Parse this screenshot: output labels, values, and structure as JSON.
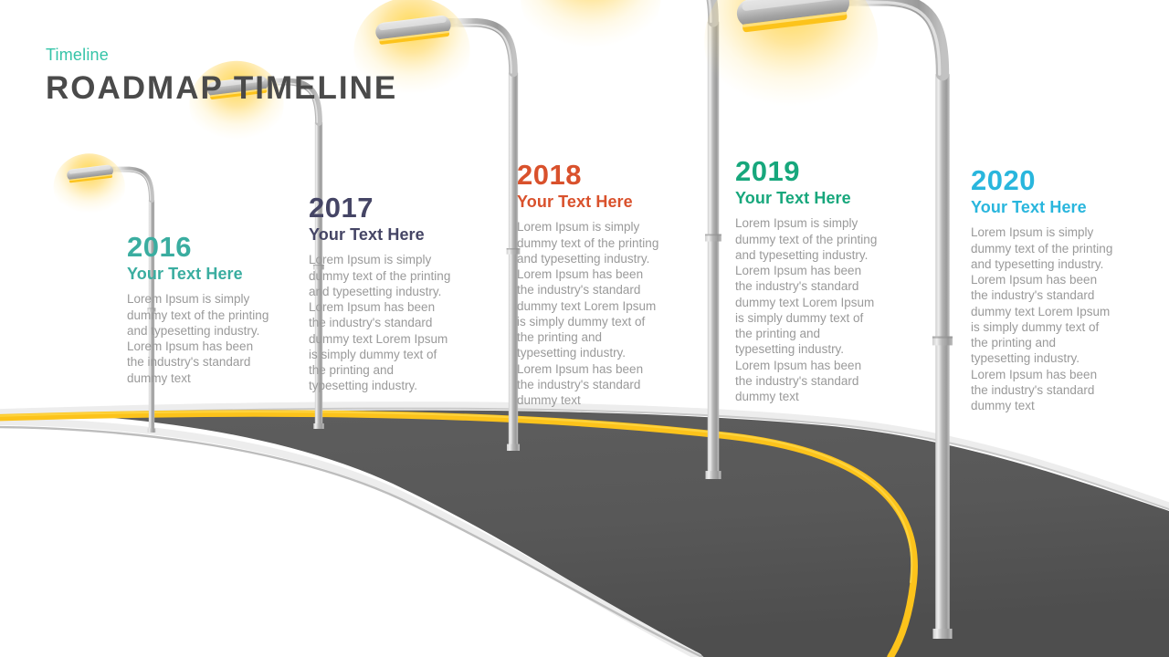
{
  "header": {
    "eyebrow": "Timeline",
    "title": "ROADMAP TIMELINE"
  },
  "palette": {
    "road_asphalt": "#575757",
    "road_edge": "#e6e6e6",
    "center_line": "#fcc31b",
    "pole_gray": "#a8a8a8",
    "lamp_glow": "#ffd24d",
    "body_text": "#9a9a9a",
    "headline": "#4a4a4a"
  },
  "paragraph": "Lorem Ipsum is simply dummy text of the printing and typesetting industry. Lorem Ipsum has been the industry's standard dummy text",
  "milestones": [
    {
      "year": "2016",
      "subtitle": "Your Text Here",
      "color": "#3aada0",
      "body": "Lorem Ipsum is simply dummy text of the printing and typesetting industry. Lorem Ipsum has been the industry's standard dummy text"
    },
    {
      "year": "2017",
      "subtitle": "Your Text Here",
      "color": "#454565",
      "body": "Lorem Ipsum is simply dummy text of the printing and typesetting industry. Lorem Ipsum has been the industry's standard dummy text Lorem Ipsum is simply dummy text of the printing and typesetting industry."
    },
    {
      "year": "2018",
      "subtitle": "Your Text Here",
      "color": "#d9512c",
      "body": "Lorem Ipsum is simply dummy text of the printing and typesetting industry. Lorem Ipsum has been the industry's standard dummy text Lorem Ipsum is simply dummy text of the printing and typesetting industry. Lorem Ipsum has been the industry's standard dummy text"
    },
    {
      "year": "2019",
      "subtitle": "Your Text Here",
      "color": "#17a77c",
      "body": "Lorem Ipsum is simply dummy text of the printing and typesetting industry. Lorem Ipsum has been the industry's standard dummy text Lorem Ipsum is simply dummy text of the printing and typesetting industry. Lorem Ipsum has been the industry's standard dummy text"
    },
    {
      "year": "2020",
      "subtitle": "Your Text Here",
      "color": "#29b6dd",
      "body": "Lorem Ipsum is simply dummy text of the printing and typesetting industry. Lorem Ipsum has been the industry's standard dummy text Lorem Ipsum is simply dummy text of the printing and typesetting industry. Lorem Ipsum has been the industry's standard dummy text"
    }
  ],
  "lamps": [
    {
      "label": "street-lamp-2016",
      "scale": 0.46
    },
    {
      "label": "street-lamp-2017",
      "scale": 0.6
    },
    {
      "label": "street-lamp-2018",
      "scale": 0.74
    },
    {
      "label": "street-lamp-2019",
      "scale": 0.9
    },
    {
      "label": "street-lamp-2020",
      "scale": 1.1
    }
  ]
}
